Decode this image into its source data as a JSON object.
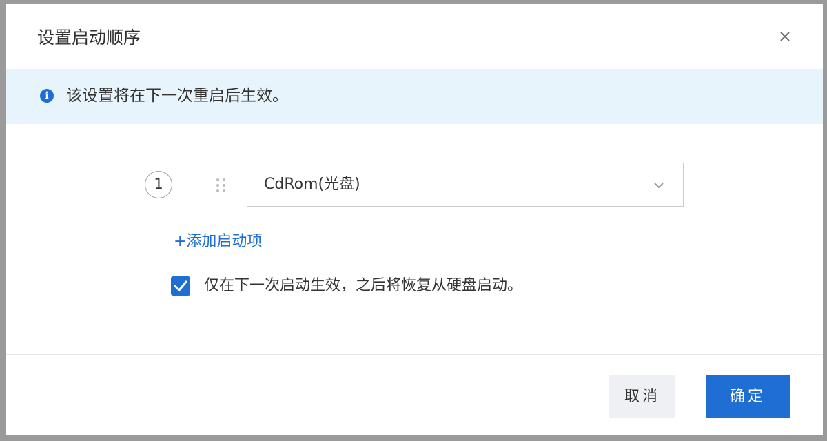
{
  "dialog": {
    "title": "设置启动顺序",
    "close_icon": "close-icon"
  },
  "notice": {
    "icon": "info-icon",
    "text": "该设置将在下一次重启后生效。",
    "background": "#e8f4fc",
    "icon_color": "#1f6ed4"
  },
  "boot_order": {
    "items": [
      {
        "index": "1",
        "drag_icon": "drag-handle-icon",
        "selected": "CdRom(光盘)",
        "arrow_icon": "chevron-down-icon"
      }
    ],
    "add_label": "+添加启动项"
  },
  "once_option": {
    "checked": true,
    "label": "仅在下一次启动生效，之后将恢复从硬盘启动。"
  },
  "footer": {
    "cancel_label": "取消",
    "ok_label": "确定"
  },
  "colors": {
    "accent": "#1f6ed4",
    "cancel_bg": "#eef0f3"
  }
}
